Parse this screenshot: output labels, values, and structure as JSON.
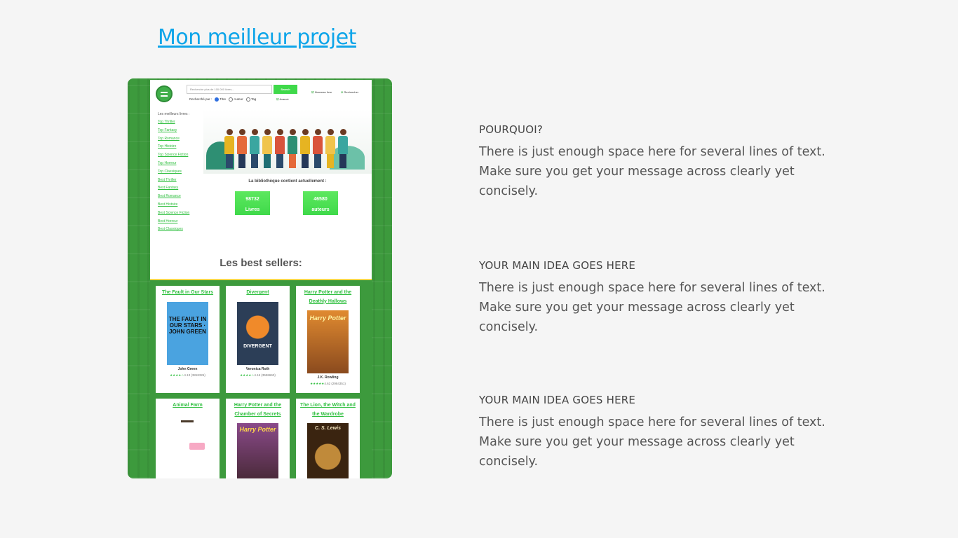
{
  "page": {
    "title": "Mon meilleur projet"
  },
  "screenshot": {
    "search": {
      "placeholder": "Recherche plus de 100 000 livres...",
      "button": "Search"
    },
    "top_links": [
      "Nouveau livre",
      "Rechercher",
      "Avancé"
    ],
    "search_by": {
      "label": "Recherché par :",
      "options": [
        "Titre",
        "Auteur",
        "Tag"
      ],
      "selected": "Titre"
    },
    "sidebar": {
      "title": "Les meilleurs livres :",
      "items": [
        "Top Thriller",
        "Top Fantasy",
        "Top Romance",
        "Top Histoire",
        "Top Science Fiction",
        "Top Horreur",
        "Top Classiques",
        "Best Thriller",
        "Best Fantasy",
        "Best Romance",
        "Best Histoire",
        "Best Science Fiction",
        "Best Horreur",
        "Best Classiques"
      ]
    },
    "library_text": "La bibliothèque contient actuellement :",
    "stats": [
      {
        "value": "98732",
        "label": "Livres"
      },
      {
        "value": "46580",
        "label": "auteurs"
      }
    ],
    "best_sellers_title": "Les best sellers:",
    "books": [
      {
        "title": "The Fault in Our Stars",
        "cover_text": "THE FAULT IN OUR STARS · JOHN GREEN",
        "cover_color": "#4aa3e0",
        "author": "John Green",
        "stars": "★★★★☆",
        "rating": "4.13 (3818326)"
      },
      {
        "title": "Divergent",
        "cover_text": "DIVERGENT",
        "cover_color": "#2c3e57",
        "author": "Veronica Roth",
        "stars": "★★★★☆",
        "rating": "4.16 (3558660)"
      },
      {
        "title": "Harry Potter and the Deathly Hallows",
        "cover_text": "Harry Potter",
        "cover_color": "#c8742a",
        "author": "J.K. Rowling",
        "stars": "★★★★★",
        "rating": "4.62 (2984351)"
      },
      {
        "title": "Animal Farm",
        "cover_text": "",
        "cover_color": "#ffffff",
        "author": "",
        "stars": "",
        "rating": ""
      },
      {
        "title": "Harry Potter and the Chamber of Secrets",
        "cover_text": "Harry Potter",
        "cover_color": "#7a3b6e",
        "author": "",
        "stars": "",
        "rating": ""
      },
      {
        "title": "The Lion, the Witch and the Wardrobe",
        "cover_text": "C. S. Lewis",
        "cover_color": "#6b4a22",
        "author": "",
        "stars": "",
        "rating": ""
      }
    ]
  },
  "sections": [
    {
      "heading": "POURQUOI?",
      "body": "There is just enough space here for several lines of text. Make sure you get your message across clearly yet concisely."
    },
    {
      "heading": "YOUR MAIN IDEA GOES HERE",
      "body": "There is just enough space here for several lines of text. Make sure you get your message across clearly yet concisely."
    },
    {
      "heading": "YOUR MAIN IDEA GOES HERE",
      "body": "There is just enough space here for several lines of text. Make sure you get your message across clearly yet concisely."
    }
  ],
  "colors": {
    "title_link": "#0ea5e9",
    "site_green": "#3fd94a"
  }
}
